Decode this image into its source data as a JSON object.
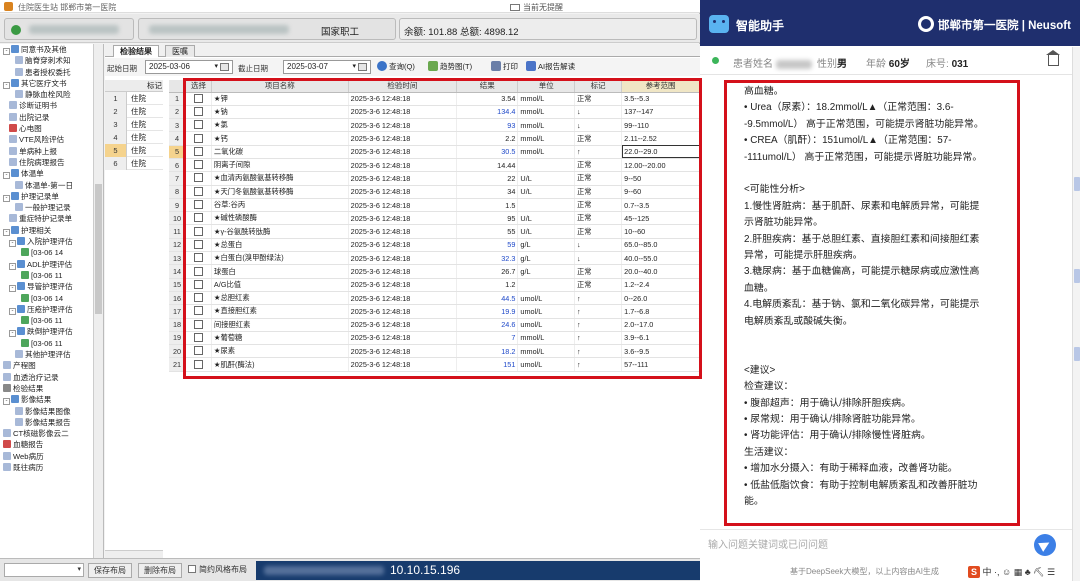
{
  "his": {
    "window_title": "住院医生站 邯郸市第一医院",
    "notice_title": "当前无提醒",
    "patient_type": "国家职工",
    "balance_text": "余额: 101.88 总额: 4898.12",
    "nav_items": [
      {
        "label": "同意书及其他",
        "indent": 0,
        "toggle": "-",
        "icon": "folder"
      },
      {
        "label": "脑脊穿刺术知",
        "indent": 2,
        "toggle": "",
        "icon": "doc"
      },
      {
        "label": "患者授权委托",
        "indent": 2,
        "toggle": "",
        "icon": "doc"
      },
      {
        "label": "其它医疗文书",
        "indent": 0,
        "toggle": "-",
        "icon": "folder"
      },
      {
        "label": "静脉血栓风险",
        "indent": 2,
        "toggle": "",
        "icon": "doc"
      },
      {
        "label": "诊断证明书",
        "indent": 1,
        "toggle": "",
        "icon": "doc"
      },
      {
        "label": "出院记录",
        "indent": 1,
        "toggle": "",
        "icon": "doc"
      },
      {
        "label": "心电图",
        "indent": 1,
        "toggle": "",
        "icon": "red"
      },
      {
        "label": "VTE风险评估",
        "indent": 1,
        "toggle": "",
        "icon": "doc"
      },
      {
        "label": "单病种上报",
        "indent": 1,
        "toggle": "",
        "icon": "doc"
      },
      {
        "label": "住院病理报告",
        "indent": 1,
        "toggle": "",
        "icon": "doc"
      },
      {
        "label": "体温单",
        "indent": 0,
        "toggle": "-",
        "icon": "folder"
      },
      {
        "label": "体温单-第一日",
        "indent": 2,
        "toggle": "",
        "icon": "doc"
      },
      {
        "label": "护理记录单",
        "indent": 0,
        "toggle": "-",
        "icon": "folder"
      },
      {
        "label": "一般护理记录",
        "indent": 2,
        "toggle": "",
        "icon": "doc"
      },
      {
        "label": "重症特护记录单",
        "indent": 1,
        "toggle": "",
        "icon": "doc"
      },
      {
        "label": "护理相关",
        "indent": 0,
        "toggle": "-",
        "icon": "folder"
      },
      {
        "label": "入院护理评估",
        "indent": 1,
        "toggle": "-",
        "icon": "folder"
      },
      {
        "label": "[03-06 14",
        "indent": 3,
        "toggle": "",
        "icon": "green"
      },
      {
        "label": "ADL护理评估",
        "indent": 1,
        "toggle": "-",
        "icon": "folder"
      },
      {
        "label": "[03-06 11",
        "indent": 3,
        "toggle": "",
        "icon": "green"
      },
      {
        "label": "导管护理评估",
        "indent": 1,
        "toggle": "-",
        "icon": "folder"
      },
      {
        "label": "[03-06 14",
        "indent": 3,
        "toggle": "",
        "icon": "green"
      },
      {
        "label": "压疮护理评估",
        "indent": 1,
        "toggle": "-",
        "icon": "folder"
      },
      {
        "label": "[03-06 11",
        "indent": 3,
        "toggle": "",
        "icon": "green"
      },
      {
        "label": "跌倒护理评估",
        "indent": 1,
        "toggle": "-",
        "icon": "folder"
      },
      {
        "label": "[03-06 11",
        "indent": 3,
        "toggle": "",
        "icon": "green"
      },
      {
        "label": "其他护理评估",
        "indent": 2,
        "toggle": "",
        "icon": "doc"
      },
      {
        "label": "产程图",
        "indent": 0,
        "toggle": "",
        "icon": "doc"
      },
      {
        "label": "血透治疗记录",
        "indent": 0,
        "toggle": "",
        "icon": "doc"
      },
      {
        "label": "检验结果",
        "indent": 0,
        "toggle": "",
        "icon": "gray"
      },
      {
        "label": "影像结果",
        "indent": 0,
        "toggle": "-",
        "icon": "folder"
      },
      {
        "label": "影像结果图像",
        "indent": 2,
        "toggle": "",
        "icon": "doc"
      },
      {
        "label": "影像结果报告",
        "indent": 2,
        "toggle": "",
        "icon": "doc"
      },
      {
        "label": "CT核磁影像云二",
        "indent": 0,
        "toggle": "",
        "icon": "doc"
      },
      {
        "label": "血糖报告",
        "indent": 0,
        "toggle": "",
        "icon": "red"
      },
      {
        "label": "Web病历",
        "indent": 0,
        "toggle": "",
        "icon": "doc"
      },
      {
        "label": "既往病历",
        "indent": 0,
        "toggle": "",
        "icon": "doc"
      }
    ],
    "bottom": {
      "save_layout": "保存布局",
      "delete_layout": "删除布局",
      "style_checkbox_label": "简约风格布局",
      "ip": "10.10.15.196"
    }
  },
  "lab": {
    "tabs": [
      "检验结果",
      "医嘱"
    ],
    "start_date_label": "起始日期",
    "start_date": "2025-03-06",
    "end_date_label": "截止日期",
    "end_date": "2025-03-07",
    "query_btn": "查询(Q)",
    "trend_btn": "趋势图(T)",
    "print_btn": "打印",
    "ai_report_btn": "AI报告解读",
    "left_header": "标记",
    "left_rows": [
      {
        "n": "1",
        "s": "住院"
      },
      {
        "n": "2",
        "s": "住院"
      },
      {
        "n": "3",
        "s": "住院"
      },
      {
        "n": "4",
        "s": "住院"
      },
      {
        "n": "5",
        "s": "住院"
      },
      {
        "n": "6",
        "s": "住院"
      }
    ],
    "columns": [
      "选择",
      "项目名称",
      "检验时间",
      "结果",
      "单位",
      "标记",
      "参考范围"
    ],
    "rows": [
      {
        "i": "1",
        "name": "★钾",
        "time": "2025-3-6 12:48:18",
        "result": "3.54",
        "unit": "mmol/L",
        "flag": "正常",
        "ref": "3.5--5.3",
        "hi": false
      },
      {
        "i": "2",
        "name": "★钠",
        "time": "2025-3-6 12:48:18",
        "result": "134.4",
        "unit": "mmol/L",
        "flag": "↓",
        "ref": "137--147",
        "hi": true
      },
      {
        "i": "3",
        "name": "★氯",
        "time": "2025-3-6 12:48:18",
        "result": "93",
        "unit": "mmol/L",
        "flag": "↓",
        "ref": "99--110",
        "hi": true
      },
      {
        "i": "4",
        "name": "★钙",
        "time": "2025-3-6 12:48:18",
        "result": "2.2",
        "unit": "mmol/L",
        "flag": "正常",
        "ref": "2.11--2.52",
        "hi": false
      },
      {
        "i": "5",
        "name": "二氧化碳",
        "time": "2025-3-6 12:48:18",
        "result": "30.5",
        "unit": "mmol/L",
        "flag": "↑",
        "ref": "22.0--29.0",
        "hi": true
      },
      {
        "i": "6",
        "name": "阴离子间隙",
        "time": "2025-3-6 12:48:18",
        "result": "14.44",
        "unit": "",
        "flag": "正常",
        "ref": "12.00--20.00",
        "hi": false
      },
      {
        "i": "7",
        "name": "★血清丙氨酸氨基转移酶",
        "time": "2025-3-6 12:48:18",
        "result": "22",
        "unit": "U/L",
        "flag": "正常",
        "ref": "9--50",
        "hi": false
      },
      {
        "i": "8",
        "name": "★天门冬氨酸氨基转移酶",
        "time": "2025-3-6 12:48:18",
        "result": "34",
        "unit": "U/L",
        "flag": "正常",
        "ref": "9--60",
        "hi": false
      },
      {
        "i": "9",
        "name": "谷草:谷丙",
        "time": "2025-3-6 12:48:18",
        "result": "1.5",
        "unit": "",
        "flag": "正常",
        "ref": "0.7--3.5",
        "hi": false
      },
      {
        "i": "10",
        "name": "★碱性磷酸酶",
        "time": "2025-3-6 12:48:18",
        "result": "95",
        "unit": "U/L",
        "flag": "正常",
        "ref": "45--125",
        "hi": false
      },
      {
        "i": "11",
        "name": "★γ-谷氨酰转肽酶",
        "time": "2025-3-6 12:48:18",
        "result": "55",
        "unit": "U/L",
        "flag": "正常",
        "ref": "10--60",
        "hi": false
      },
      {
        "i": "12",
        "name": "★总蛋白",
        "time": "2025-3-6 12:48:18",
        "result": "59",
        "unit": "g/L",
        "flag": "↓",
        "ref": "65.0--85.0",
        "hi": true
      },
      {
        "i": "13",
        "name": "★白蛋白(溴甲酚绿法)",
        "time": "2025-3-6 12:48:18",
        "result": "32.3",
        "unit": "g/L",
        "flag": "↓",
        "ref": "40.0--55.0",
        "hi": true
      },
      {
        "i": "14",
        "name": "球蛋白",
        "time": "2025-3-6 12:48:18",
        "result": "26.7",
        "unit": "g/L",
        "flag": "正常",
        "ref": "20.0--40.0",
        "hi": false
      },
      {
        "i": "15",
        "name": "A/G比值",
        "time": "2025-3-6 12:48:18",
        "result": "1.2",
        "unit": "",
        "flag": "正常",
        "ref": "1.2--2.4",
        "hi": false
      },
      {
        "i": "16",
        "name": "★总胆红素",
        "time": "2025-3-6 12:48:18",
        "result": "44.5",
        "unit": "umol/L",
        "flag": "↑",
        "ref": "0--26.0",
        "hi": true
      },
      {
        "i": "17",
        "name": "★直接胆红素",
        "time": "2025-3-6 12:48:18",
        "result": "19.9",
        "unit": "umol/L",
        "flag": "↑",
        "ref": "1.7--6.8",
        "hi": true
      },
      {
        "i": "18",
        "name": "间接胆红素",
        "time": "2025-3-6 12:48:18",
        "result": "24.6",
        "unit": "umol/L",
        "flag": "↑",
        "ref": "2.0--17.0",
        "hi": true
      },
      {
        "i": "19",
        "name": "★葡萄糖",
        "time": "2025-3-6 12:48:18",
        "result": "7",
        "unit": "mmol/L",
        "flag": "↑",
        "ref": "3.9--6.1",
        "hi": true
      },
      {
        "i": "20",
        "name": "★尿素",
        "time": "2025-3-6 12:48:18",
        "result": "18.2",
        "unit": "mmol/L",
        "flag": "↑",
        "ref": "3.6--9.5",
        "hi": true
      },
      {
        "i": "21",
        "name": "★肌酐(酶法)",
        "time": "2025-3-6 12:48:18",
        "result": "151",
        "unit": "umol/L",
        "flag": "↑",
        "ref": "57--111",
        "hi": true
      }
    ]
  },
  "ai": {
    "title": "智能助手",
    "hospital": "邯郸市第一医院 | Neusoft",
    "patient_name_label": "患者姓名",
    "gender_label": "性别",
    "gender": "男",
    "age_label": "年龄",
    "age": "60岁",
    "bed_label": "床号:",
    "bed": "031",
    "content_lines": [
      "高血糖。",
      "• Urea（尿素）：18.2mmol/L▲（正常范围：3.6-",
      "-9.5mmol/L） 高于正常范围，可能提示肾脏功能异常。",
      "• CREA（肌酐）：151umol/L▲（正常范围：57-",
      "-111umol/L） 高于正常范围，可能提示肾脏功能异常。",
      "",
      "<可能性分析>",
      "1.慢性肾脏病：基于肌酐、尿素和电解质异常，可能提",
      "示肾脏功能异常。",
      "2.肝胆疾病：基于总胆红素、直接胆红素和间接胆红素",
      "异常，可能提示肝胆疾病。",
      "3.糖尿病：基于血糖偏高，可能提示糖尿病或应激性高",
      "血糖。",
      "4.电解质紊乱：基于钠、氯和二氧化碳异常，可能提示",
      "电解质紊乱或酸碱失衡。",
      "",
      "",
      "<建议>",
      "检查建议：",
      "• 腹部超声：用于确认/排除肝胆疾病。",
      "• 尿常规：用于确认/排除肾脏功能异常。",
      "• 肾功能评估：用于确认/排除慢性肾脏病。",
      "生活建议：",
      "• 增加水分摄入：有助于稀释血液，改善肾功能。",
      "• 低盐低脂饮食：有助于控制电解质紊乱和改善肝脏功",
      "能。"
    ],
    "input_placeholder": "输入问题关键词或已问问题",
    "footnote": "基于DeepSeek大模型，以上内容由AI生成",
    "ime_tray": "S中 ·, ☺ ▦ ♣ ⛏ ☰"
  },
  "colors": {
    "highlight_red": "#d4101a",
    "ai_header": "#1f2f6e",
    "abnormal_value": "#1f49c9",
    "selected_row": "#f5d38d"
  }
}
